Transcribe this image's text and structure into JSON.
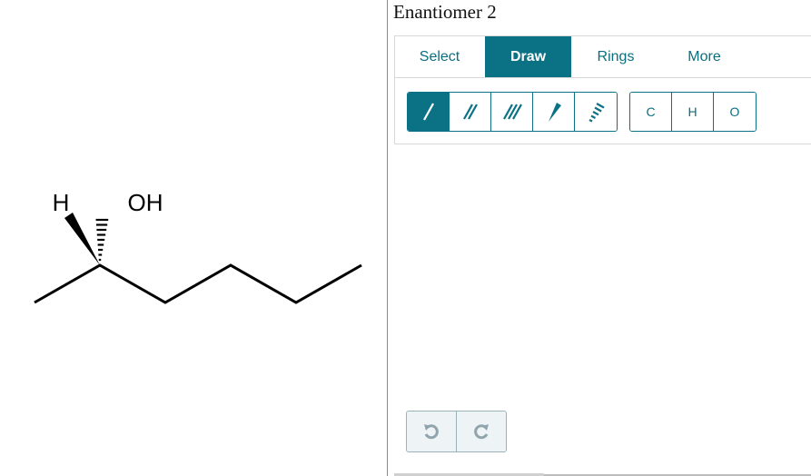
{
  "molecule": {
    "atom_labels": {
      "hydrogen": "H",
      "hydroxyl": "OH"
    }
  },
  "editor": {
    "title": "Enantiomer 2",
    "tabs": [
      {
        "label": "Select",
        "active": false
      },
      {
        "label": "Draw",
        "active": true
      },
      {
        "label": "Rings",
        "active": false
      },
      {
        "label": "More",
        "active": false
      }
    ],
    "bond_tools": [
      {
        "icon": "single-bond-icon",
        "active": true
      },
      {
        "icon": "double-bond-icon",
        "active": false
      },
      {
        "icon": "triple-bond-icon",
        "active": false
      },
      {
        "icon": "wedge-bond-icon",
        "active": false
      },
      {
        "icon": "hash-bond-icon",
        "active": false
      }
    ],
    "atom_tools": [
      {
        "label": "C"
      },
      {
        "label": "H"
      },
      {
        "label": "O"
      }
    ],
    "history": [
      {
        "icon": "undo-icon"
      },
      {
        "icon": "redo-icon"
      }
    ]
  },
  "colors": {
    "accent": "#0b7286",
    "accent_text": "#0a6e80",
    "disabled_bg": "#eef3f5"
  }
}
